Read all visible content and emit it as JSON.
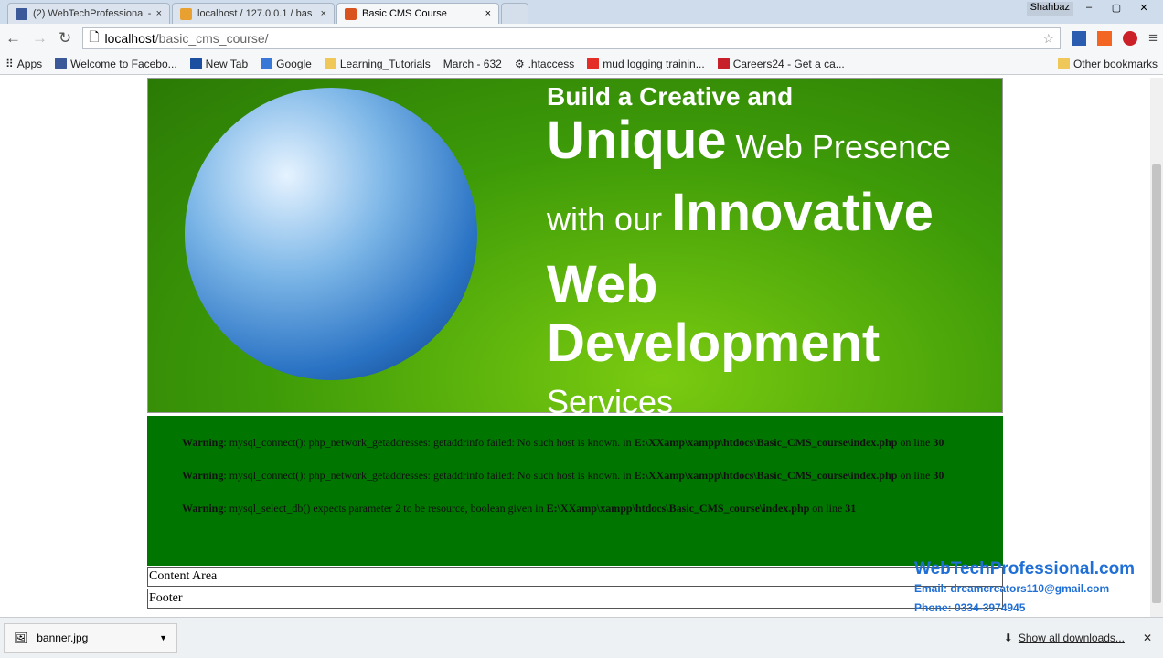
{
  "tabs": [
    {
      "label": "(2) WebTechProfessional -"
    },
    {
      "label": "localhost / 127.0.0.1 / bas"
    },
    {
      "label": "Basic CMS Course"
    }
  ],
  "window_user": "Shahbaz",
  "address": {
    "host": "localhost",
    "path": "/basic_cms_course/"
  },
  "bookmarks": [
    "Apps",
    "Welcome to Facebo...",
    "New Tab",
    "Google",
    "Learning_Tutorials",
    "March - 632",
    ".htaccess",
    "mud logging trainin...",
    "Careers24 - Get a ca..."
  ],
  "other_bookmarks": "Other bookmarks",
  "banner": {
    "line0": "Build a Creative and",
    "l1a": "Unique",
    "l1b": " Web Presence",
    "l2a": "with our ",
    "l2b": "Innovative",
    "l3": "Web Development",
    "l4": "Services"
  },
  "warnings": [
    {
      "label": "Warning",
      "msg": ": mysql_connect(): php_network_getaddresses: getaddrinfo failed: No such host is known. in ",
      "file": "E:\\XXamp\\xampp\\htdocs\\Basic_CMS_course\\index.php",
      "on": " on line ",
      "line": "30"
    },
    {
      "label": "Warning",
      "msg": ": mysql_connect(): php_network_getaddresses: getaddrinfo failed: No such host is known. in ",
      "file": "E:\\XXamp\\xampp\\htdocs\\Basic_CMS_course\\index.php",
      "on": " on line ",
      "line": "30"
    },
    {
      "label": "Warning",
      "msg": ": mysql_select_db() expects parameter 2 to be resource, boolean given in ",
      "file": "E:\\XXamp\\xampp\\htdocs\\Basic_CMS_course\\index.php",
      "on": " on line ",
      "line": "31"
    }
  ],
  "content_area": "Content Area",
  "footer": "Footer",
  "watermark": {
    "site": "WebTechProfessional.com",
    "email": "Email: dreamcreators110@gmail.com",
    "phone": "Phone: 0334-3974945"
  },
  "downloads": {
    "file": "banner.jpg",
    "show_all": "Show all downloads..."
  }
}
